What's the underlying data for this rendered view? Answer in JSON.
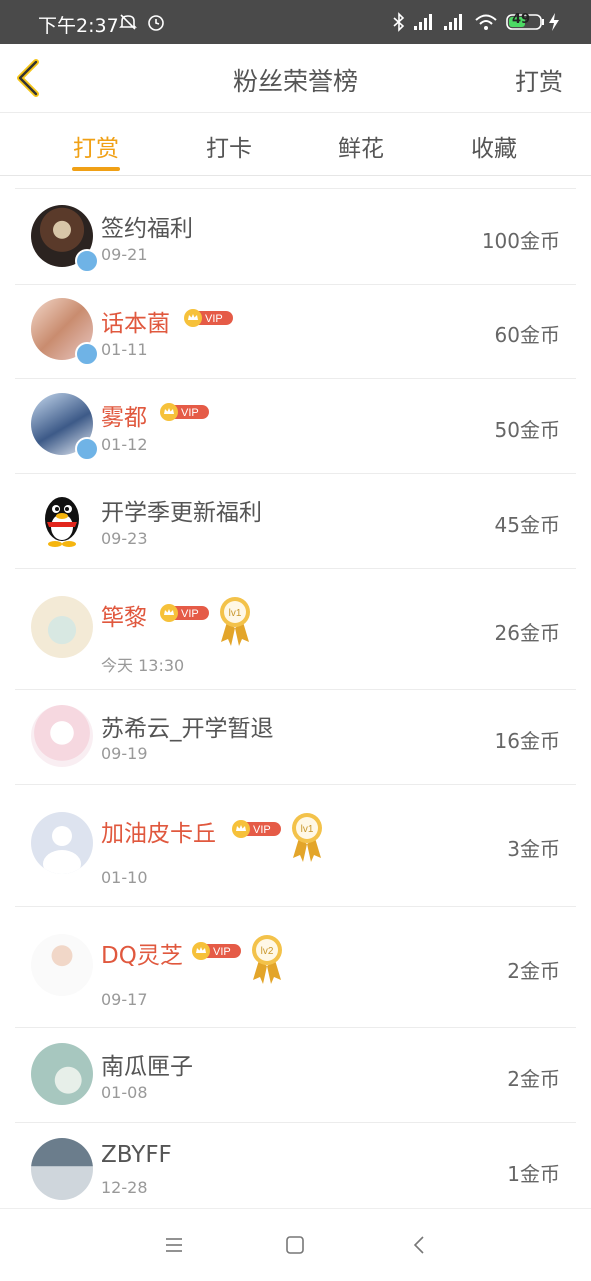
{
  "status_bar": {
    "time": "下午2:37",
    "battery": "49"
  },
  "header": {
    "title": "粉丝荣誉榜",
    "action_label": "打赏"
  },
  "tabs": [
    {
      "label": "打赏",
      "active": true
    },
    {
      "label": "打卡",
      "active": false
    },
    {
      "label": "鲜花",
      "active": false
    },
    {
      "label": "收藏",
      "active": false
    }
  ],
  "vip_label": "VIP",
  "rows": [
    {
      "name": "签约福利",
      "date": "09-21",
      "coins": "100金币"
    },
    {
      "name": "话本菌",
      "date": "01-11",
      "coins": "60金币"
    },
    {
      "name": "雾都",
      "date": "01-12",
      "coins": "50金币"
    },
    {
      "name": "开学季更新福利",
      "date": "09-23",
      "coins": "45金币"
    },
    {
      "name": "筚黎",
      "date": "今天 13:30",
      "coins": "26金币",
      "medal": "lv1"
    },
    {
      "name": "苏希云_开学暂退",
      "date": "09-19",
      "coins": "16金币"
    },
    {
      "name": "加油皮卡丘",
      "date": "01-10",
      "coins": "3金币",
      "medal": "lv1"
    },
    {
      "name": "DQ灵芝",
      "date": "09-17",
      "coins": "2金币",
      "medal": "lv2"
    },
    {
      "name": "南瓜匣子",
      "date": "01-08",
      "coins": "2金币"
    },
    {
      "name": "ZBYFF",
      "date": "12-28",
      "coins": "1金币"
    }
  ],
  "colors": {
    "accent": "#f0a015",
    "vip_name": "#e0583e",
    "status_bar": "#4a4a4a"
  }
}
